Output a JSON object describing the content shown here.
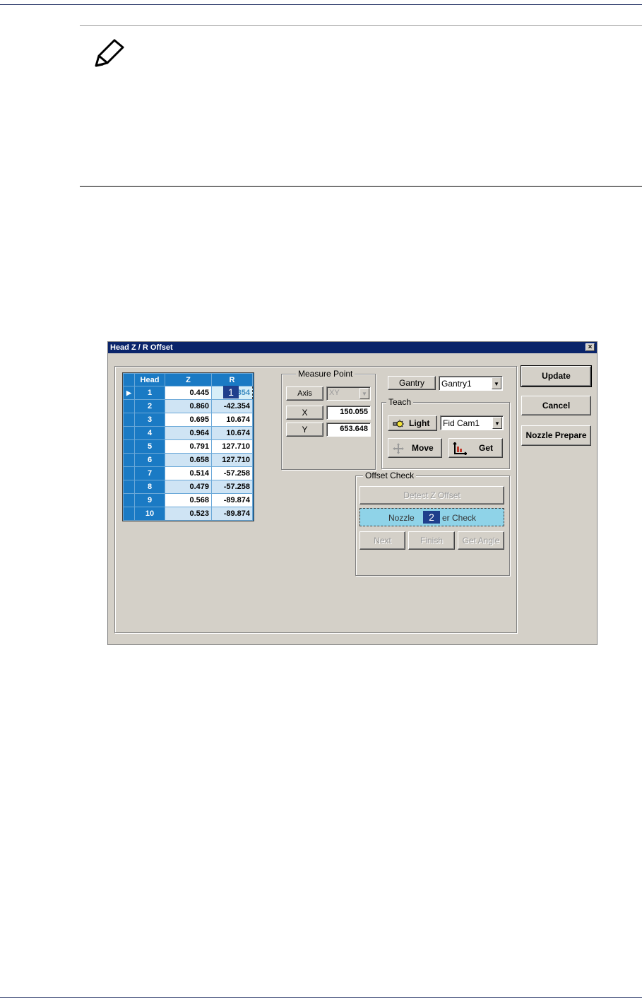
{
  "dialog": {
    "title": "Head Z / R Offset",
    "close_glyph": "×",
    "grid": {
      "headers": [
        "Head",
        "Z",
        "R"
      ],
      "rows": [
        {
          "head": "1",
          "z": "0.445",
          "r": "854"
        },
        {
          "head": "2",
          "z": "0.860",
          "r": "-42.354"
        },
        {
          "head": "3",
          "z": "0.695",
          "r": "10.674"
        },
        {
          "head": "4",
          "z": "0.964",
          "r": "10.674"
        },
        {
          "head": "5",
          "z": "0.791",
          "r": "127.710"
        },
        {
          "head": "6",
          "z": "0.658",
          "r": "127.710"
        },
        {
          "head": "7",
          "z": "0.514",
          "r": "-57.258"
        },
        {
          "head": "8",
          "z": "0.479",
          "r": "-57.258"
        },
        {
          "head": "9",
          "z": "0.568",
          "r": "-89.874"
        },
        {
          "head": "10",
          "z": "0.523",
          "r": "-89.874"
        }
      ]
    },
    "measure_point": {
      "label": "Measure Point",
      "axis_label": "Axis",
      "axis_value": "XY",
      "x_label": "X",
      "x_value": "150.055",
      "y_label": "Y",
      "y_value": "653.648"
    },
    "gantry": {
      "label": "Gantry",
      "value": "Gantry1"
    },
    "teach": {
      "label": "Teach",
      "light_label": "Light",
      "camera_value": "Fid Cam1",
      "move_label": "Move",
      "get_label": "Get"
    },
    "offset_check": {
      "label": "Offset Check",
      "detect_label": "Detect Z Offset",
      "nozzle_check_left": "Nozzle",
      "nozzle_check_right": "er Check",
      "next_label": "Next",
      "finish_label": "Finish",
      "get_angle_label": "Get Angle"
    },
    "buttons": {
      "update": "Update",
      "cancel": "Cancel",
      "nozzle_prepare": "Nozzle Prepare"
    },
    "callouts": {
      "one": "1",
      "two": "2"
    }
  },
  "colors": {
    "accent": "#1a7ac4",
    "title_bar": "#0a246a",
    "highlight_button": "#8fd3e8",
    "rule": "#2b3a6b"
  },
  "icons": [
    "pencil-note-icon",
    "row-pointer-icon",
    "bulb-icon",
    "move-arrows-icon",
    "get-position-icon",
    "close-icon",
    "chevron-down-icon"
  ]
}
